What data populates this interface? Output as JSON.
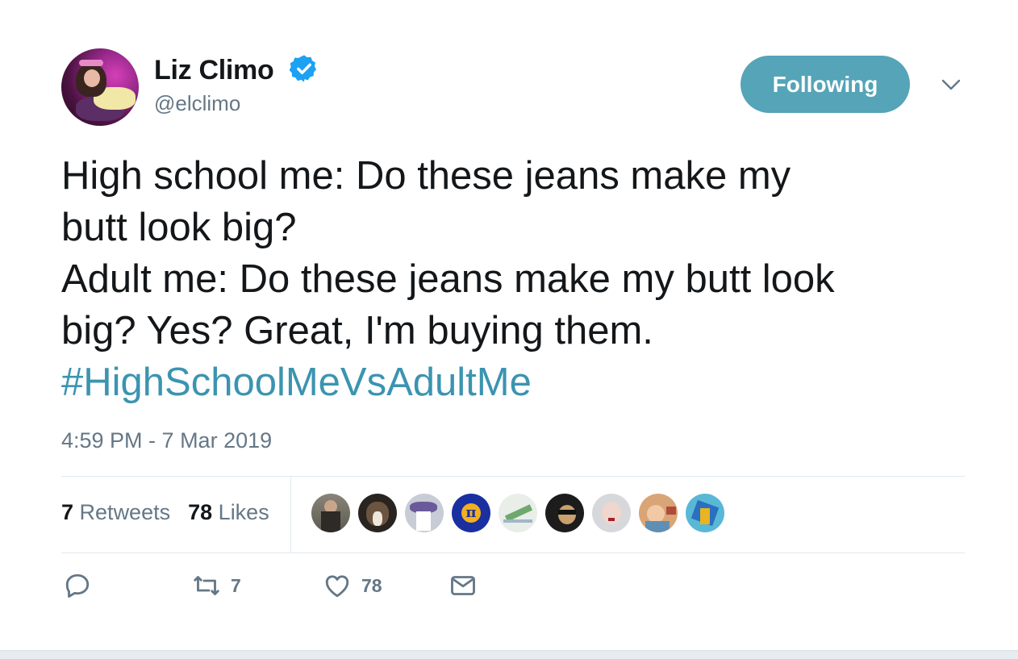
{
  "user": {
    "name": "Liz Climo",
    "handle": "@elclimo",
    "verified_color": "#1da1f2"
  },
  "follow_button": {
    "label": "Following",
    "color": "#55a4b8"
  },
  "tweet": {
    "lines": [
      "High school me: Do these jeans make my",
      "butt look big?",
      "Adult me: Do these jeans make my butt look",
      "big? Yes? Great, I'm buying them."
    ],
    "hashtag": "#HighSchoolMeVsAdultMe",
    "hashtag_color": "#3b94b0",
    "timestamp": "4:59 PM - 7 Mar 2019"
  },
  "stats": {
    "retweets_count": "7",
    "retweets_label": "Retweets",
    "likes_count": "78",
    "likes_label": "Likes"
  },
  "likers_icons": [
    "person-avatar",
    "dog-avatar",
    "cartoon-avatar",
    "pi-avatar",
    "map-avatar",
    "sunglasses-avatar",
    "face-avatar",
    "person-avatar",
    "bird-avatar"
  ],
  "actions": {
    "reply_icon": "reply-icon",
    "retweet_count": "7",
    "like_count": "78",
    "dm_icon": "envelope-icon"
  }
}
